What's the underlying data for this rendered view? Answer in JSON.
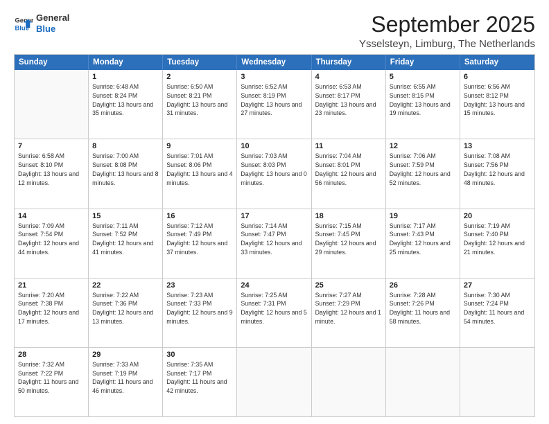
{
  "logo": {
    "line1": "General",
    "line2": "Blue"
  },
  "header": {
    "month": "September 2025",
    "location": "Ysselsteyn, Limburg, The Netherlands"
  },
  "weekdays": [
    "Sunday",
    "Monday",
    "Tuesday",
    "Wednesday",
    "Thursday",
    "Friday",
    "Saturday"
  ],
  "rows": [
    [
      {
        "day": "",
        "sunrise": "",
        "sunset": "",
        "daylight": ""
      },
      {
        "day": "1",
        "sunrise": "Sunrise: 6:48 AM",
        "sunset": "Sunset: 8:24 PM",
        "daylight": "Daylight: 13 hours and 35 minutes."
      },
      {
        "day": "2",
        "sunrise": "Sunrise: 6:50 AM",
        "sunset": "Sunset: 8:21 PM",
        "daylight": "Daylight: 13 hours and 31 minutes."
      },
      {
        "day": "3",
        "sunrise": "Sunrise: 6:52 AM",
        "sunset": "Sunset: 8:19 PM",
        "daylight": "Daylight: 13 hours and 27 minutes."
      },
      {
        "day": "4",
        "sunrise": "Sunrise: 6:53 AM",
        "sunset": "Sunset: 8:17 PM",
        "daylight": "Daylight: 13 hours and 23 minutes."
      },
      {
        "day": "5",
        "sunrise": "Sunrise: 6:55 AM",
        "sunset": "Sunset: 8:15 PM",
        "daylight": "Daylight: 13 hours and 19 minutes."
      },
      {
        "day": "6",
        "sunrise": "Sunrise: 6:56 AM",
        "sunset": "Sunset: 8:12 PM",
        "daylight": "Daylight: 13 hours and 15 minutes."
      }
    ],
    [
      {
        "day": "7",
        "sunrise": "Sunrise: 6:58 AM",
        "sunset": "Sunset: 8:10 PM",
        "daylight": "Daylight: 13 hours and 12 minutes."
      },
      {
        "day": "8",
        "sunrise": "Sunrise: 7:00 AM",
        "sunset": "Sunset: 8:08 PM",
        "daylight": "Daylight: 13 hours and 8 minutes."
      },
      {
        "day": "9",
        "sunrise": "Sunrise: 7:01 AM",
        "sunset": "Sunset: 8:06 PM",
        "daylight": "Daylight: 13 hours and 4 minutes."
      },
      {
        "day": "10",
        "sunrise": "Sunrise: 7:03 AM",
        "sunset": "Sunset: 8:03 PM",
        "daylight": "Daylight: 13 hours and 0 minutes."
      },
      {
        "day": "11",
        "sunrise": "Sunrise: 7:04 AM",
        "sunset": "Sunset: 8:01 PM",
        "daylight": "Daylight: 12 hours and 56 minutes."
      },
      {
        "day": "12",
        "sunrise": "Sunrise: 7:06 AM",
        "sunset": "Sunset: 7:59 PM",
        "daylight": "Daylight: 12 hours and 52 minutes."
      },
      {
        "day": "13",
        "sunrise": "Sunrise: 7:08 AM",
        "sunset": "Sunset: 7:56 PM",
        "daylight": "Daylight: 12 hours and 48 minutes."
      }
    ],
    [
      {
        "day": "14",
        "sunrise": "Sunrise: 7:09 AM",
        "sunset": "Sunset: 7:54 PM",
        "daylight": "Daylight: 12 hours and 44 minutes."
      },
      {
        "day": "15",
        "sunrise": "Sunrise: 7:11 AM",
        "sunset": "Sunset: 7:52 PM",
        "daylight": "Daylight: 12 hours and 41 minutes."
      },
      {
        "day": "16",
        "sunrise": "Sunrise: 7:12 AM",
        "sunset": "Sunset: 7:49 PM",
        "daylight": "Daylight: 12 hours and 37 minutes."
      },
      {
        "day": "17",
        "sunrise": "Sunrise: 7:14 AM",
        "sunset": "Sunset: 7:47 PM",
        "daylight": "Daylight: 12 hours and 33 minutes."
      },
      {
        "day": "18",
        "sunrise": "Sunrise: 7:15 AM",
        "sunset": "Sunset: 7:45 PM",
        "daylight": "Daylight: 12 hours and 29 minutes."
      },
      {
        "day": "19",
        "sunrise": "Sunrise: 7:17 AM",
        "sunset": "Sunset: 7:43 PM",
        "daylight": "Daylight: 12 hours and 25 minutes."
      },
      {
        "day": "20",
        "sunrise": "Sunrise: 7:19 AM",
        "sunset": "Sunset: 7:40 PM",
        "daylight": "Daylight: 12 hours and 21 minutes."
      }
    ],
    [
      {
        "day": "21",
        "sunrise": "Sunrise: 7:20 AM",
        "sunset": "Sunset: 7:38 PM",
        "daylight": "Daylight: 12 hours and 17 minutes."
      },
      {
        "day": "22",
        "sunrise": "Sunrise: 7:22 AM",
        "sunset": "Sunset: 7:36 PM",
        "daylight": "Daylight: 12 hours and 13 minutes."
      },
      {
        "day": "23",
        "sunrise": "Sunrise: 7:23 AM",
        "sunset": "Sunset: 7:33 PM",
        "daylight": "Daylight: 12 hours and 9 minutes."
      },
      {
        "day": "24",
        "sunrise": "Sunrise: 7:25 AM",
        "sunset": "Sunset: 7:31 PM",
        "daylight": "Daylight: 12 hours and 5 minutes."
      },
      {
        "day": "25",
        "sunrise": "Sunrise: 7:27 AM",
        "sunset": "Sunset: 7:29 PM",
        "daylight": "Daylight: 12 hours and 1 minute."
      },
      {
        "day": "26",
        "sunrise": "Sunrise: 7:28 AM",
        "sunset": "Sunset: 7:26 PM",
        "daylight": "Daylight: 11 hours and 58 minutes."
      },
      {
        "day": "27",
        "sunrise": "Sunrise: 7:30 AM",
        "sunset": "Sunset: 7:24 PM",
        "daylight": "Daylight: 11 hours and 54 minutes."
      }
    ],
    [
      {
        "day": "28",
        "sunrise": "Sunrise: 7:32 AM",
        "sunset": "Sunset: 7:22 PM",
        "daylight": "Daylight: 11 hours and 50 minutes."
      },
      {
        "day": "29",
        "sunrise": "Sunrise: 7:33 AM",
        "sunset": "Sunset: 7:19 PM",
        "daylight": "Daylight: 11 hours and 46 minutes."
      },
      {
        "day": "30",
        "sunrise": "Sunrise: 7:35 AM",
        "sunset": "Sunset: 7:17 PM",
        "daylight": "Daylight: 11 hours and 42 minutes."
      },
      {
        "day": "",
        "sunrise": "",
        "sunset": "",
        "daylight": ""
      },
      {
        "day": "",
        "sunrise": "",
        "sunset": "",
        "daylight": ""
      },
      {
        "day": "",
        "sunrise": "",
        "sunset": "",
        "daylight": ""
      },
      {
        "day": "",
        "sunrise": "",
        "sunset": "",
        "daylight": ""
      }
    ]
  ]
}
